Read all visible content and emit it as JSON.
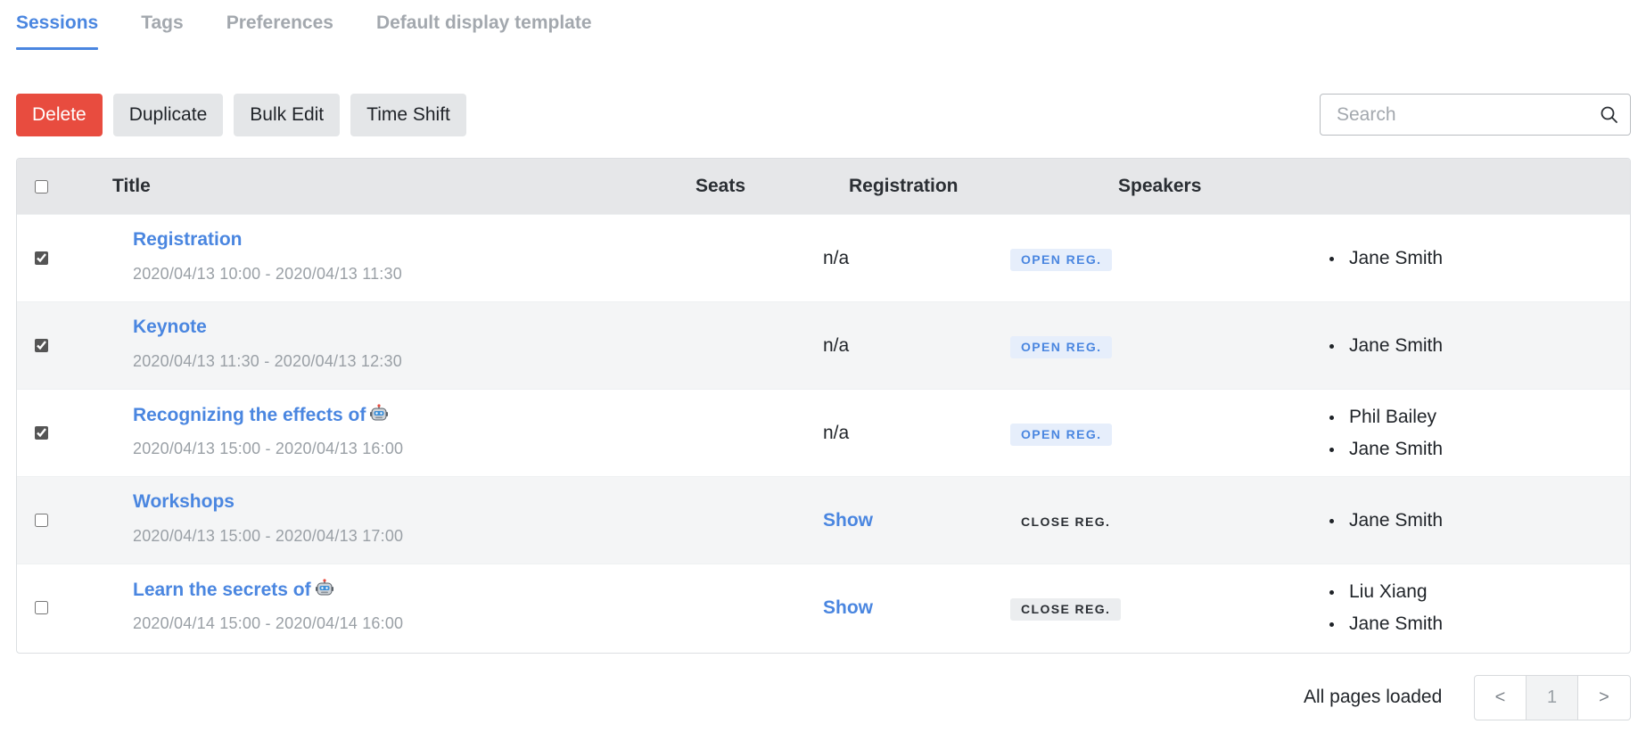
{
  "tabs": [
    {
      "label": "Sessions",
      "active": true
    },
    {
      "label": "Tags",
      "active": false
    },
    {
      "label": "Preferences",
      "active": false
    },
    {
      "label": "Default display template",
      "active": false
    }
  ],
  "toolbar": {
    "delete_label": "Delete",
    "duplicate_label": "Duplicate",
    "bulk_edit_label": "Bulk Edit",
    "time_shift_label": "Time Shift"
  },
  "search": {
    "placeholder": "Search",
    "value": ""
  },
  "table": {
    "headers": {
      "title": "Title",
      "seats": "Seats",
      "registration": "Registration",
      "speakers": "Speakers"
    },
    "rows": [
      {
        "checked": true,
        "title": "Registration",
        "has_icon": false,
        "time": "2020/04/13 10:00 - 2020/04/13 11:30",
        "seats": "n/a",
        "registration": "OPEN REG.",
        "speakers": [
          "Jane Smith"
        ]
      },
      {
        "checked": true,
        "title": "Keynote",
        "has_icon": false,
        "time": "2020/04/13 11:30 - 2020/04/13 12:30",
        "seats": "n/a",
        "registration": "OPEN REG.",
        "speakers": [
          "Jane Smith"
        ]
      },
      {
        "checked": true,
        "title": "Recognizing the effects of",
        "has_icon": true,
        "icon": "robot-icon",
        "time": "2020/04/13 15:00 - 2020/04/13 16:00",
        "seats": "n/a",
        "registration": "OPEN REG.",
        "speakers": [
          "Phil Bailey",
          "Jane Smith"
        ]
      },
      {
        "checked": false,
        "title": "Workshops",
        "has_icon": false,
        "time": "2020/04/13 15:00 - 2020/04/13 17:00",
        "seats": "Show",
        "registration": "CLOSE REG.",
        "speakers": [
          "Jane Smith"
        ]
      },
      {
        "checked": false,
        "title": "Learn the secrets of",
        "has_icon": true,
        "icon": "robot-icon",
        "time": "2020/04/14 15:00 - 2020/04/14 16:00",
        "seats": "Show",
        "registration": "CLOSE REG.",
        "speakers": [
          "Liu Xiang",
          "Jane Smith"
        ]
      }
    ]
  },
  "footer": {
    "status": "All pages loaded",
    "prev_label": "<",
    "current_page": "1",
    "next_label": ">"
  },
  "colors": {
    "accent": "#4a86e0",
    "danger": "#e84c3f",
    "header_bg": "#e6e7e9",
    "badge_open_bg": "#e6eefb"
  }
}
